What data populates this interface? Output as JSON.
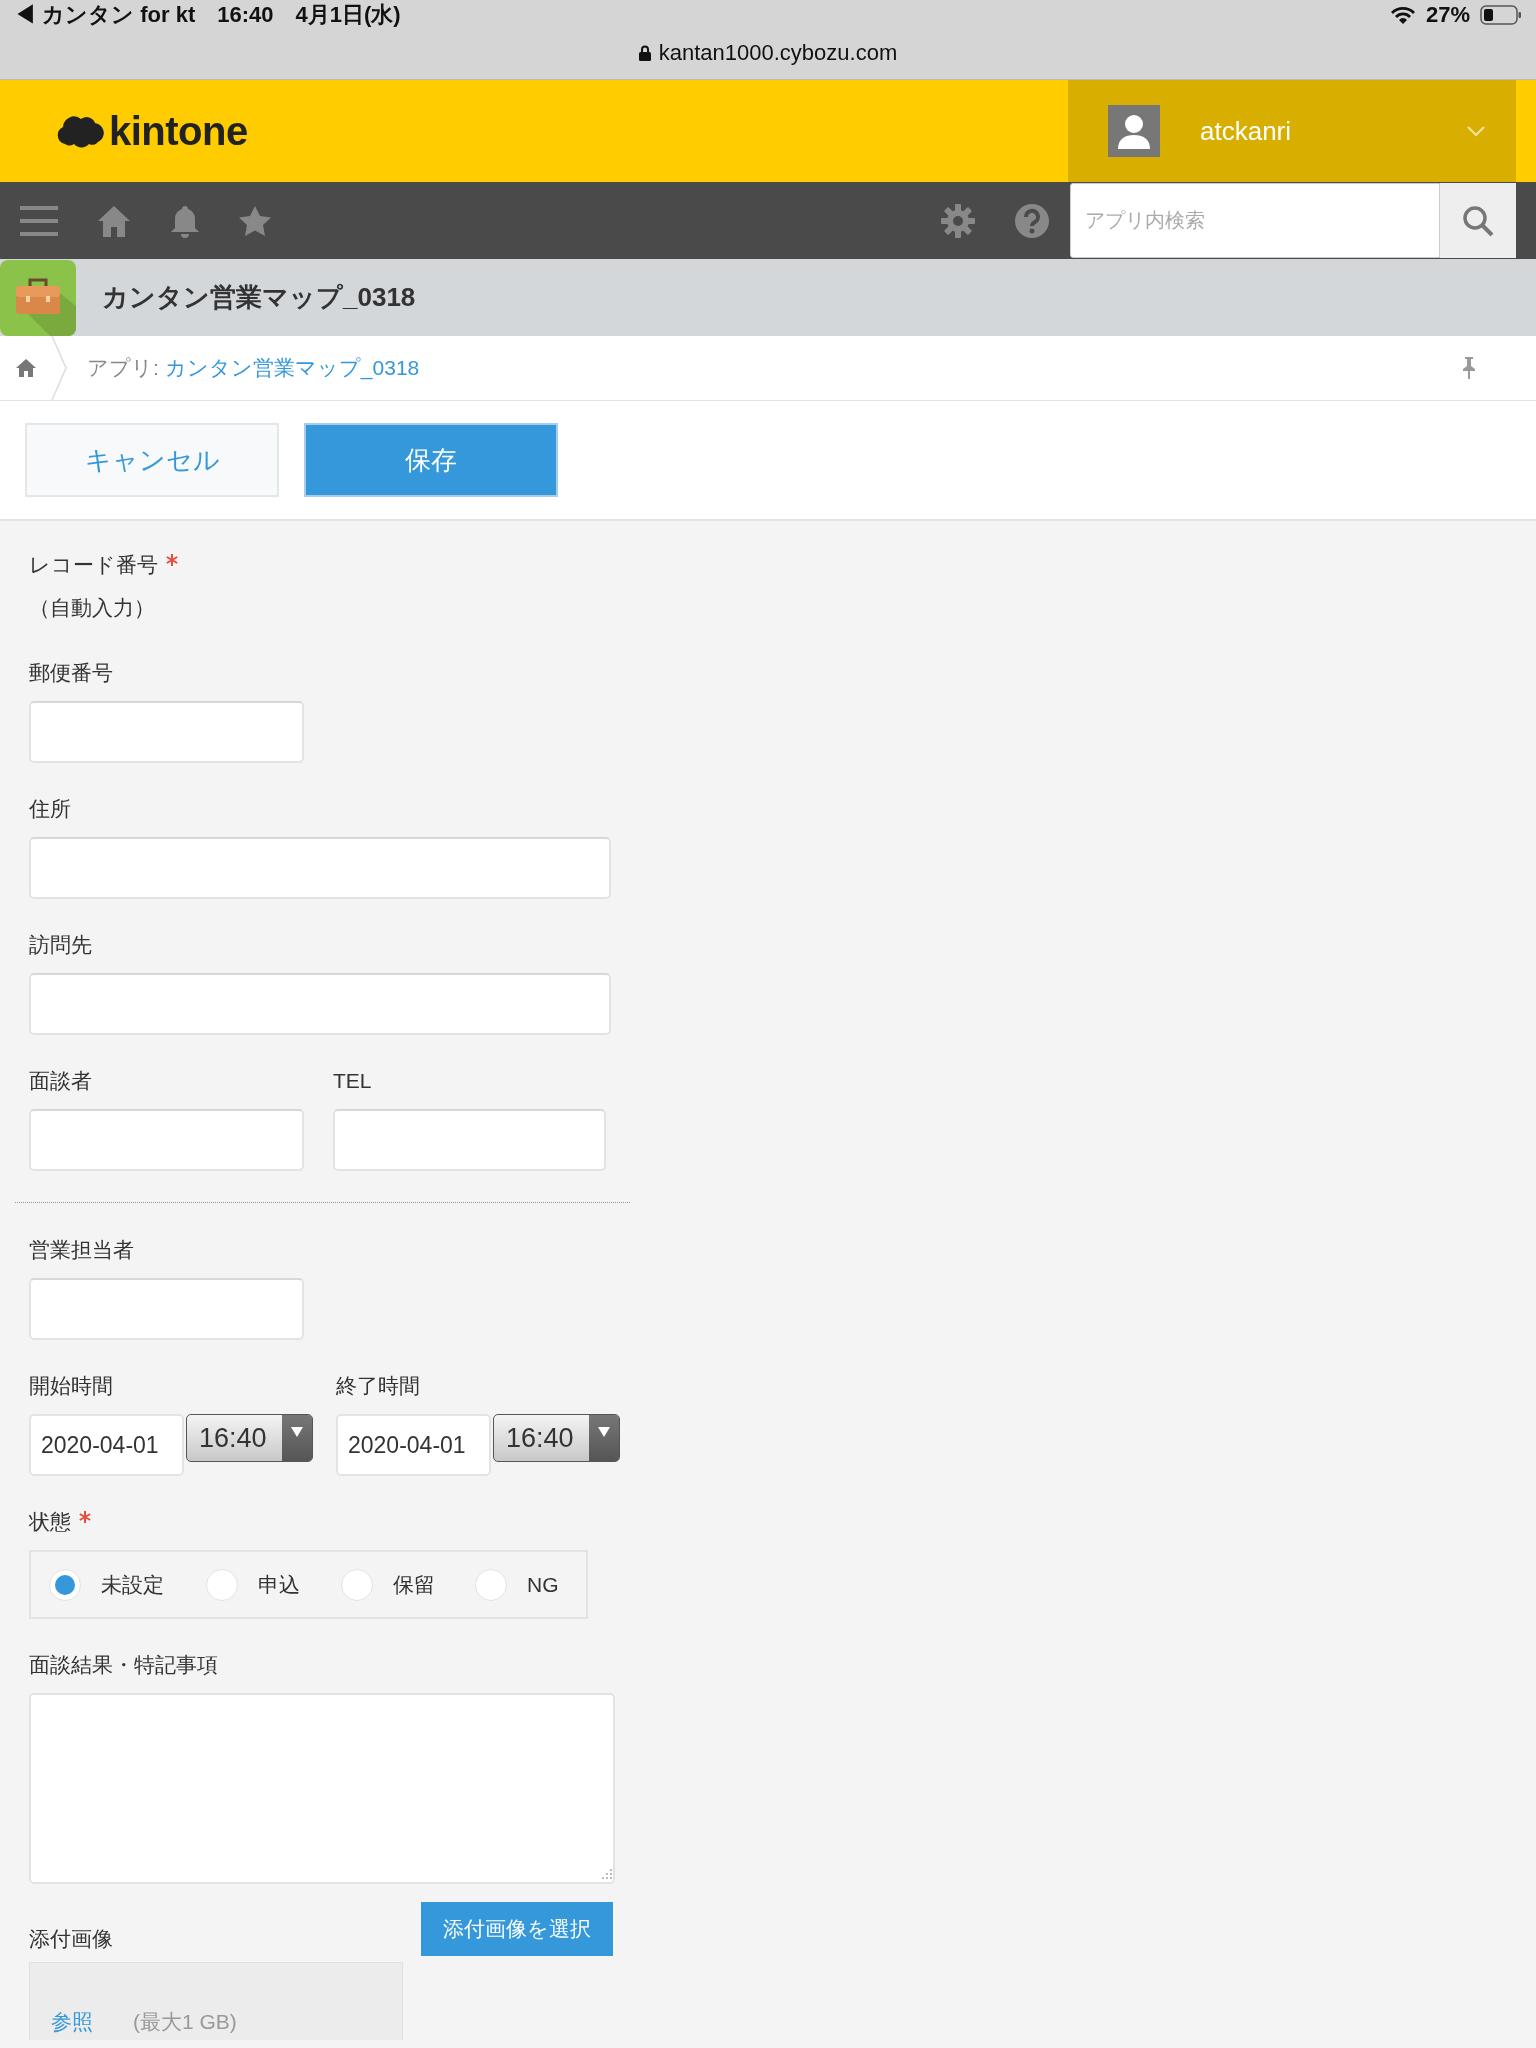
{
  "status_bar": {
    "back_app": "◀ カンタン for kt",
    "time": "16:40",
    "date": "4月1日(水)",
    "battery": "27%",
    "url": "kantan1000.cybozu.com"
  },
  "header": {
    "logo": "kintone",
    "user": "atckanri"
  },
  "nav": {
    "search_placeholder": "アプリ内検索"
  },
  "app": {
    "title": "カンタン営業マップ_0318"
  },
  "breadcrumb": {
    "prefix": "アプリ:",
    "link": "カンタン営業マップ_0318"
  },
  "actions": [
    {
      "label": "キャンセル",
      "kind": "secondary"
    },
    {
      "label": "保存",
      "kind": "primary"
    }
  ],
  "form": {
    "rows": [
      {
        "kind": "fields",
        "fields": [
          {
            "kind": "readonly",
            "label": "レコード番号",
            "required": true,
            "value": "（自動入力）"
          }
        ]
      },
      {
        "kind": "fields",
        "fields": [
          {
            "kind": "text",
            "label": "郵便番号",
            "required": false,
            "wide": false
          }
        ]
      },
      {
        "kind": "fields",
        "fields": [
          {
            "kind": "text",
            "label": "住所",
            "required": false,
            "wide": true
          }
        ]
      },
      {
        "kind": "fields",
        "fields": [
          {
            "kind": "text",
            "label": "訪問先",
            "required": false,
            "wide": true
          }
        ]
      },
      {
        "kind": "fields",
        "fields": [
          {
            "kind": "text",
            "label": "面談者",
            "required": false,
            "wide": false
          },
          {
            "kind": "text",
            "label": "TEL",
            "required": false,
            "wide": false
          }
        ]
      },
      {
        "kind": "divider"
      },
      {
        "kind": "fields",
        "fields": [
          {
            "kind": "text",
            "label": "営業担当者",
            "required": false,
            "wide": false
          }
        ]
      },
      {
        "kind": "fields",
        "fields": [
          {
            "kind": "datetime",
            "label": "開始時間",
            "required": false,
            "date": "2020-04-01",
            "time": "16:40"
          },
          {
            "kind": "datetime",
            "label": "終了時間",
            "required": false,
            "date": "2020-04-01",
            "time": "16:40"
          }
        ]
      },
      {
        "kind": "fields",
        "fields": [
          {
            "kind": "radio",
            "label": "状態",
            "required": true,
            "options": [
              {
                "label": "未設定",
                "selected": true
              },
              {
                "label": "申込",
                "selected": false
              },
              {
                "label": "保留",
                "selected": false
              },
              {
                "label": "NG",
                "selected": false
              }
            ]
          }
        ]
      },
      {
        "kind": "fields",
        "fields": [
          {
            "kind": "textarea",
            "label": "面談結果・特記事項",
            "required": false
          }
        ]
      },
      {
        "kind": "fields",
        "fields": [
          {
            "kind": "attachment",
            "label": "添付画像",
            "required": false,
            "button": "添付画像を選択",
            "browse": "参照",
            "note": "(最大1 GB)"
          }
        ]
      }
    ]
  }
}
